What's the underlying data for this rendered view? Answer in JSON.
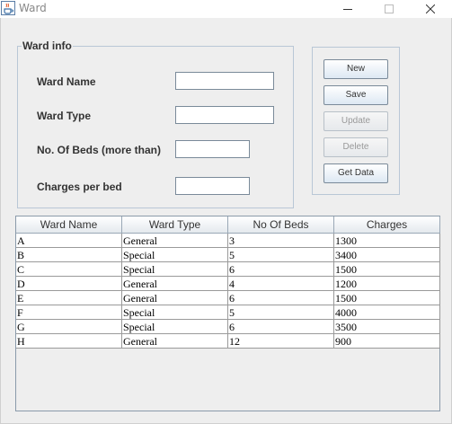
{
  "window": {
    "title": "Ward",
    "app_icon": "java-cup-icon",
    "controls": [
      "minimize-icon",
      "maximize-icon",
      "close-icon"
    ]
  },
  "form": {
    "group_title": "Ward info",
    "fields": [
      {
        "label": "Ward Name",
        "value": ""
      },
      {
        "label": "Ward Type",
        "value": ""
      },
      {
        "label": "No. Of Beds (more than)",
        "value": ""
      },
      {
        "label": "Charges per bed",
        "value": ""
      }
    ]
  },
  "actions": {
    "new": {
      "label": "New",
      "enabled": true
    },
    "save": {
      "label": "Save",
      "enabled": true
    },
    "update": {
      "label": "Update",
      "enabled": false
    },
    "delete": {
      "label": "Delete",
      "enabled": false
    },
    "get_data": {
      "label": "Get Data",
      "enabled": true
    }
  },
  "table": {
    "columns": [
      "Ward Name",
      "Ward Type",
      "No Of Beds",
      "Charges"
    ],
    "rows": [
      [
        "A",
        "General",
        "3",
        "1300"
      ],
      [
        "B",
        "Special",
        "5",
        "3400"
      ],
      [
        "C",
        "Special",
        "6",
        "1500"
      ],
      [
        "D",
        "General",
        "4",
        "1200"
      ],
      [
        "E",
        "General",
        "6",
        "1500"
      ],
      [
        "F",
        "Special",
        "5",
        "4000"
      ],
      [
        "G",
        "Special",
        "6",
        "3500"
      ],
      [
        "H",
        "General",
        "12",
        "900"
      ]
    ]
  },
  "colors": {
    "window_bg": "#eeeeee",
    "border_blue": "#b9c7d6",
    "disabled_text": "#999999"
  }
}
